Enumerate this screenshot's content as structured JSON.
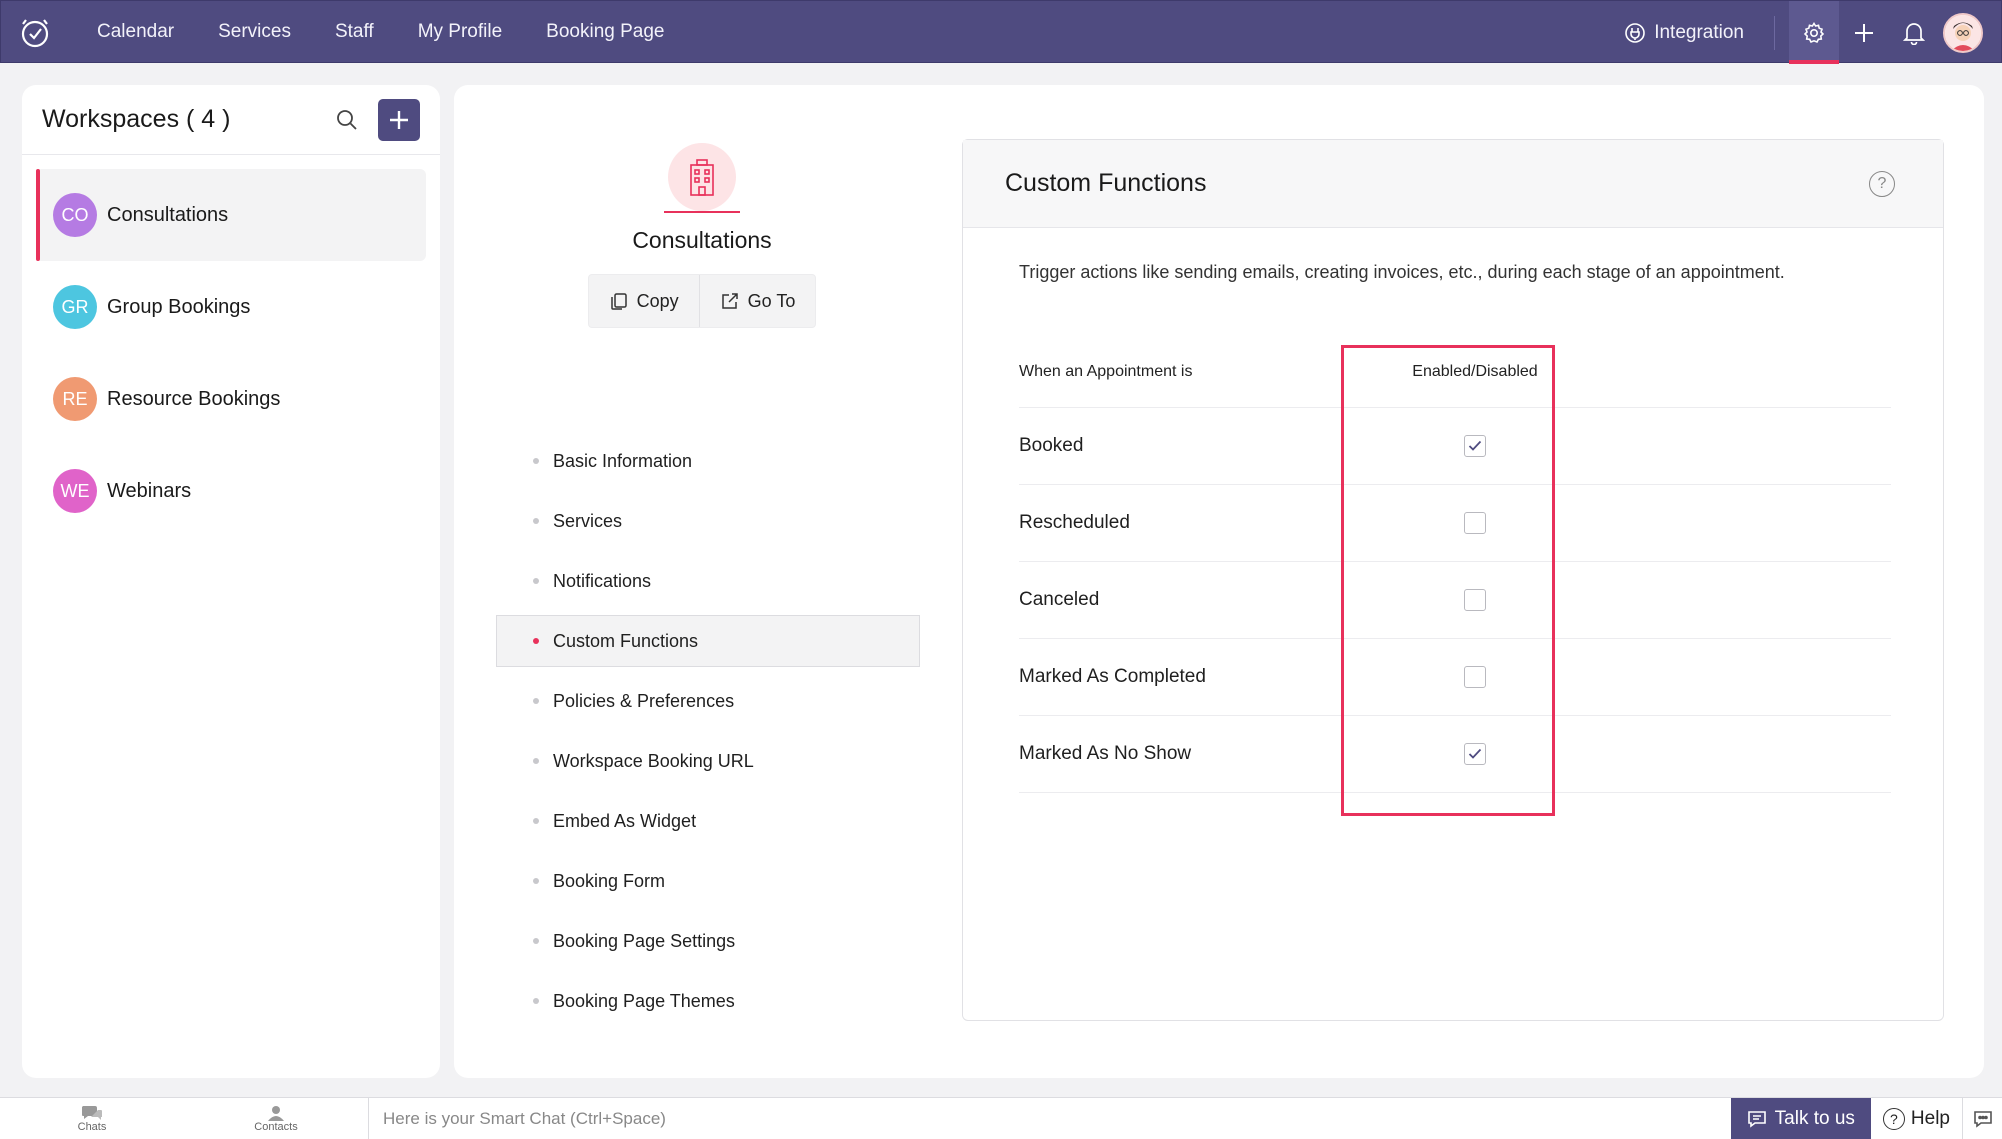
{
  "topnav": {
    "links": [
      "Calendar",
      "Services",
      "Staff",
      "My Profile",
      "Booking Page"
    ],
    "integration_label": "Integration",
    "icons": [
      "app-logo-icon",
      "integration-icon",
      "settings-gear-icon",
      "add-plus-icon",
      "notification-bell-icon",
      "user-avatar"
    ]
  },
  "workspaces": {
    "title": "Workspaces ( 4 )",
    "items": [
      {
        "initials": "CO",
        "name": "Consultations",
        "color": "#b57be3",
        "active": true
      },
      {
        "initials": "GR",
        "name": "Group Bookings",
        "color": "#4dc6e0",
        "active": false
      },
      {
        "initials": "RE",
        "name": "Resource Bookings",
        "color": "#f09a72",
        "active": false
      },
      {
        "initials": "WE",
        "name": "Webinars",
        "color": "#e063c9",
        "active": false
      }
    ]
  },
  "workspace_detail": {
    "title": "Consultations",
    "copy_label": "Copy",
    "goto_label": "Go To"
  },
  "menu": [
    "Basic Information",
    "Services",
    "Notifications",
    "Custom Functions",
    "Policies & Preferences",
    "Workspace Booking URL",
    "Embed As Widget",
    "Booking Form",
    "Booking Page Settings",
    "Booking Page Themes"
  ],
  "active_menu": "Custom Functions",
  "custom_functions": {
    "title": "Custom Functions",
    "help": "?",
    "description": "Trigger actions like sending emails, creating invoices, etc., during each stage of an appointment.",
    "col1_header": "When an Appointment is",
    "col2_header": "Enabled/Disabled",
    "rows": [
      {
        "label": "Booked",
        "enabled": true
      },
      {
        "label": "Rescheduled",
        "enabled": false
      },
      {
        "label": "Canceled",
        "enabled": false
      },
      {
        "label": "Marked As Completed",
        "enabled": false
      },
      {
        "label": "Marked As No Show",
        "enabled": true
      }
    ]
  },
  "bottombar": {
    "chats_label": "Chats",
    "contacts_label": "Contacts",
    "chat_placeholder": "Here is your Smart Chat (Ctrl+Space)",
    "talk_label": "Talk to us",
    "help_label": "Help"
  },
  "colors": {
    "nav_bg": "#4f4b80",
    "accent": "#e8315b"
  }
}
